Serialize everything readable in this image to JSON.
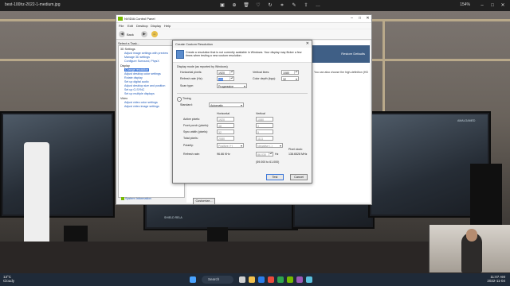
{
  "viewer": {
    "filename": "best-100hz-2022-1-medium.jpg",
    "zoom": "154%"
  },
  "ncp": {
    "title": "NVIDIA Control Panel",
    "menu": [
      "File",
      "Edit",
      "Desktop",
      "Display",
      "Help"
    ],
    "back_label": "Back",
    "task_label": "Select a Task...",
    "tree": [
      {
        "label": "3D Settings",
        "type": "cat"
      },
      {
        "label": "Adjust image settings with preview",
        "type": "sub"
      },
      {
        "label": "Manage 3D settings",
        "type": "sub"
      },
      {
        "label": "Configure Surround, PhysX",
        "type": "sub"
      },
      {
        "label": "Display",
        "type": "cat"
      },
      {
        "label": "Change resolution",
        "type": "sel"
      },
      {
        "label": "Adjust desktop color settings",
        "type": "sub"
      },
      {
        "label": "Rotate display",
        "type": "sub"
      },
      {
        "label": "Set up digital audio",
        "type": "sub"
      },
      {
        "label": "Adjust desktop size and position",
        "type": "sub"
      },
      {
        "label": "Set up G-SYNC",
        "type": "sub"
      },
      {
        "label": "Set up multiple displays",
        "type": "sub"
      },
      {
        "label": "Video",
        "type": "cat"
      },
      {
        "label": "Adjust video color settings",
        "type": "sub"
      },
      {
        "label": "Adjust video image settings",
        "type": "sub"
      }
    ],
    "restore_defaults": "Restore Defaults",
    "right_text": "You can also choose the high-definition (HD",
    "customize": "Customize...",
    "system_info": "System Information"
  },
  "dialog": {
    "title": "Create Custom Resolution",
    "banner": "Create a resolution that is not currently available in Windows. Your display may flicker a few times when testing a new custom resolution.",
    "mode_label": "Display mode (as reported by Windows)",
    "horizontal_pixels_label": "Horizontal pixels:",
    "horizontal_pixels": "1920",
    "vertical_lines_label": "Vertical lines:",
    "vertical_lines": "1080",
    "refresh_rate_label": "Refresh rate (Hz):",
    "refresh_rate": "100",
    "color_depth_label": "Color depth (bpp):",
    "color_depth": "32",
    "scan_type_label": "Scan type:",
    "scan_type": "Progressive",
    "timing_label": "Timing",
    "standard_label": "Standard:",
    "standard": "Automatic",
    "col_horizontal": "Horizontal",
    "col_vertical": "Vertical",
    "rows": [
      {
        "label": "Active pixels:",
        "h": "1920",
        "v": "1080"
      },
      {
        "label": "Front porch (pixels):",
        "h": "48",
        "v": "3"
      },
      {
        "label": "Sync width (pixels):",
        "h": "32",
        "v": "5"
      },
      {
        "label": "Total pixels:",
        "h": "2080",
        "v": "1111"
      },
      {
        "label": "Polarity:",
        "h": "Positive (+)",
        "v": "Negative (-)"
      }
    ],
    "refresh_label": "Refresh rate:",
    "refresh_khz": "96.66 KHz",
    "refresh_hz": "86.030",
    "hz_unit": "Hz",
    "pixel_clock_label": "Pixel clock:",
    "pixel_clock": "138.6528 MHz",
    "range_text": "(59.000 to 61.000)",
    "test_label": "Test",
    "cancel_label": "Cancel"
  },
  "photo": {
    "hud_left": "AMALGAMED",
    "hud_bottom": "SHIELD RELA"
  },
  "taskbar": {
    "temp": "13°C",
    "weather": "Cloudy",
    "search": "Search",
    "time": "11:07 AM",
    "date": "2022-11-04"
  },
  "colors": {
    "nvidia_green": "#76b900",
    "header_blue": "#3f5f86",
    "selection_blue": "#3874d8"
  }
}
